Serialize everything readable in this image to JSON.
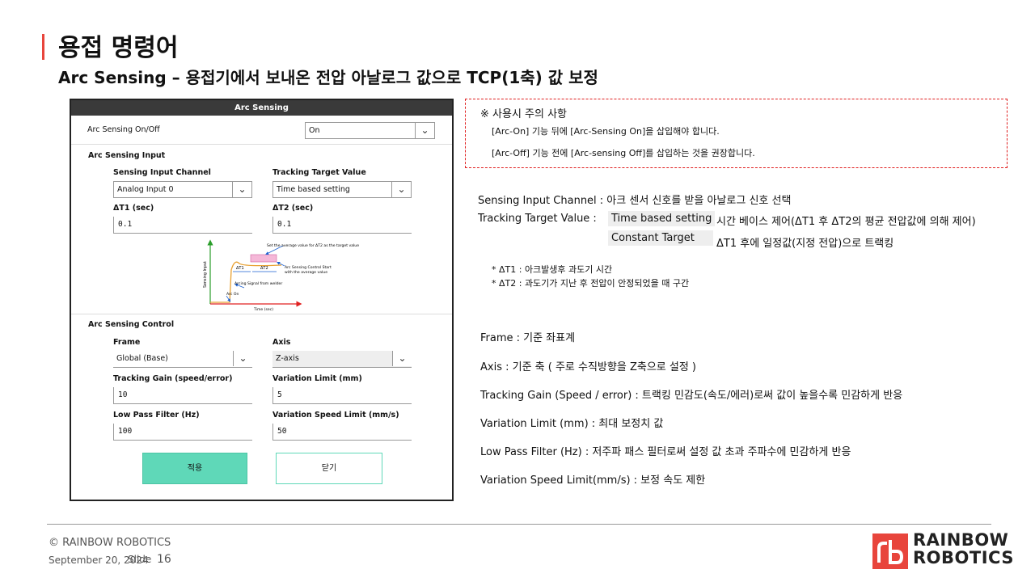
{
  "header": {
    "title": "용접 명령어",
    "subtitle": "Arc Sensing – 용접기에서 보내온 전압 아날로그 값으로 TCP(1축) 값 보정"
  },
  "dialog": {
    "title": "Arc Sensing",
    "on_off_label": "Arc Sensing On/Off",
    "on_off_value": "On",
    "input_section": "Arc Sensing Input",
    "channel_label": "Sensing Input Channel",
    "channel_value": "Analog Input 0",
    "target_label": "Tracking Target Value",
    "target_value": "Time based setting",
    "t1_label": "ΔT1 (sec)",
    "t1_value": "0.1",
    "t2_label": "ΔT2 (sec)",
    "t2_value": "0.1",
    "diagram": {
      "top_note": "Set the average value for ΔT2 as the target value",
      "t1": "ΔT1",
      "t2": "ΔT2",
      "control_start_1": "Arc Sensing Control Start",
      "control_start_2": "with the average value",
      "arcing_signal": "Arcing Signal from welder",
      "arc_on": "Arc On",
      "ylabel": "Sensing Input",
      "xlabel": "Time (sec)"
    },
    "control_section": "Arc Sensing Control",
    "frame_label": "Frame",
    "frame_value": "Global (Base)",
    "axis_label": "Axis",
    "axis_value": "Z-axis",
    "gain_label": "Tracking Gain (speed/error)",
    "gain_value": "10",
    "varlimit_label": "Variation Limit (mm)",
    "varlimit_value": "5",
    "lpf_label": "Low Pass Filter (Hz)",
    "lpf_value": "100",
    "varspeed_label": "Variation Speed Limit (mm/s)",
    "varspeed_value": "50",
    "apply": "적용",
    "close": "닫기"
  },
  "notice": {
    "title": "※ 사용시 주의 사항",
    "line1": "[Arc-On] 기능 뒤에 [Arc-Sensing On]을 삽입해야 합니다.",
    "line2": "[Arc-Off] 기능 전에 [Arc-sensing Off]를 삽입하는 것을 권장합니다."
  },
  "desc": {
    "channel": "Sensing Input Channel : 아크 센서 신호를 받을 아날로그 신호 선택",
    "target_label": "Tracking Target Value :",
    "target_opt1": "Time based setting",
    "target_opt1_desc": "시간 베이스 제어(ΔT1 후 ΔT2의 평균 전압값에 의해 제어)",
    "target_opt2": "Constant Target",
    "target_opt2_desc": "ΔT1 후에 일정값(지정 전압)으로 트랙킹",
    "note1": "* ΔT1 : 아크발생후 과도기 시간",
    "note2": "* ΔT2 : 과도기가 지난 후 전압이 안정되었을 때 구간",
    "frame": "Frame : 기준 좌표계",
    "axis": "Axis : 기준 축 ( 주로 수직방향을 Z축으로 설정 )",
    "gain": "Tracking Gain (Speed / error) : 트랙킹 민감도(속도/에러)로써 값이 높을수록 민감하게 반응",
    "varlimit": "Variation Limit (mm) : 최대 보정치 값",
    "lpf": "Low Pass Filter (Hz) : 저주파 패스 필터로써 설정 값 초과 주파수에 민감하게 반응",
    "varspeed": "Variation Speed Limit(mm/s) : 보정 속도 제한"
  },
  "footer": {
    "copyright": "© RAINBOW ROBOTICS",
    "date": "September 20, 2024",
    "slide_label": "Slide",
    "slide_number": "16",
    "logo_line1": "RAINBOW",
    "logo_line2": "ROBOTICS"
  }
}
